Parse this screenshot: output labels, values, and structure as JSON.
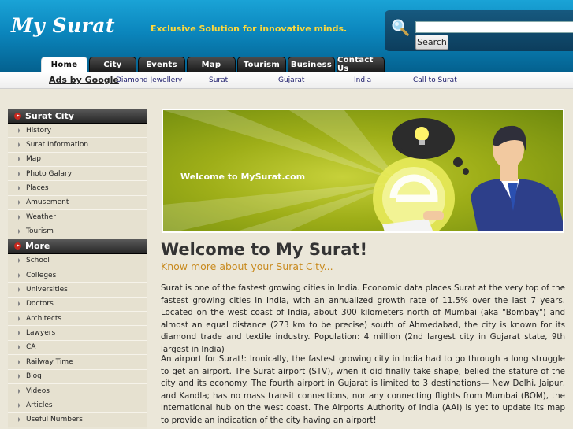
{
  "header": {
    "logo": "My Surat",
    "tagline": "Exclusive Solution for innovative minds.",
    "search_placeholder": "",
    "search_button": "Search"
  },
  "tabs": [
    {
      "label": "Home",
      "active": true
    },
    {
      "label": "City"
    },
    {
      "label": "Events"
    },
    {
      "label": "Map"
    },
    {
      "label": "Tourism"
    },
    {
      "label": "Business"
    },
    {
      "label": "Contact Us"
    }
  ],
  "ads": {
    "label": "Ads by Google",
    "links": [
      "Diamond Jewellery",
      "Surat",
      "Gujarat",
      "India",
      "Call to Surat"
    ]
  },
  "sidebar": {
    "section1": {
      "title": "Surat City",
      "items": [
        "History",
        "Surat Information",
        "Map",
        "Photo Galary",
        "Places",
        "Amusement",
        "Weather",
        "Tourism"
      ]
    },
    "section2": {
      "title": "More",
      "items": [
        "School",
        "Colleges",
        "Universities",
        "Doctors",
        "Architects",
        "Lawyers",
        "CA",
        "Railway Time",
        "Blog",
        "Videos",
        "Articles",
        "Useful Numbers"
      ]
    }
  },
  "banner": {
    "text": "Welcome to MySurat.com"
  },
  "main": {
    "title": "Welcome to My Surat!",
    "subtitle": "Know more about your Surat City...",
    "para1": "Surat is one of the fastest growing cities in India. Economic data places Surat at the very top of the fastest growing cities in India, with an annualized growth rate of 11.5% over the last 7 years. Located on the west coast of India, about 300 kilometers north of Mumbai (aka \"Bombay\") and almost an equal distance (273 km to be precise) south of Ahmedabad, the city is known for its diamond trade and textile industry. Population: 4 million (2nd largest city in Gujarat state, 9th largest in India)",
    "para2": "An airport for Surat!: Ironically, the fastest growing city in India had to go through a long struggle to get an airport. The Surat airport (STV), when it did finally take shape, belied the stature of the city and its economy. The fourth airport in Gujarat is limited to 3 destinations— New Delhi, Jaipur, and Kandla; has no mass transit connections, nor any connecting flights from Mumbai (BOM), the international hub on the west coast. The Airports Authority of India (AAI) is yet to update its map to provide an indication of the city having an airport!"
  },
  "colors": {
    "header_blue": "#0b86bd",
    "tagline_yellow": "#ffd93a",
    "subtitle_orange": "#c88a1e",
    "banner_green": "#9eae18"
  }
}
